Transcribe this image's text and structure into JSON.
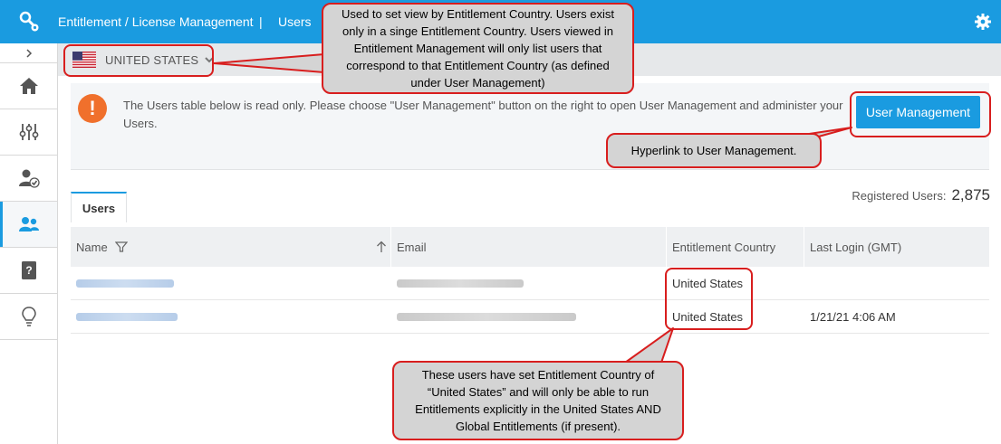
{
  "header": {
    "breadcrumb_section": "Entitlement / License Management",
    "breadcrumb_separator": "|",
    "breadcrumb_page": "Users"
  },
  "subheader": {
    "country": "UNITED STATES"
  },
  "notice": {
    "text": "The Users table below is read only. Please choose \"User Management\" button on the right to open User Management and administer your Users."
  },
  "actions": {
    "user_management_label": "User Management"
  },
  "tabs": [
    {
      "label": "Users",
      "active": true
    }
  ],
  "stats": {
    "registered_label": "Registered Users:",
    "registered_count": "2,875"
  },
  "table": {
    "columns": [
      "Name",
      "Email",
      "Entitlement Country",
      "Last Login (GMT)"
    ],
    "rows": [
      {
        "entitlement_country": "United States",
        "last_login": ""
      },
      {
        "entitlement_country": "United States",
        "last_login": "1/21/21 4:06 AM"
      }
    ]
  },
  "annotations": {
    "country_view": "Used to set view by Entitlement Country. Users exist only in a singe Entitlement Country. Users viewed in Entitlement Management will only list users that correspond to that Entitlement Country (as defined under User Management)",
    "hyperlink": "Hyperlink to User Management.",
    "users_country": "These users have  set Entitlement Country of “United States” and will only be able to run Entitlements explicitly in the United States AND Global Entitlements (if present)."
  },
  "colors": {
    "brand": "#1a9be0",
    "warning": "#f0702c",
    "annotation_border": "#d81e1e",
    "annotation_fill": "#d4d4d4"
  },
  "icons": {
    "app": "key-gear-icon",
    "settings": "gear-icon",
    "sidebar": [
      "home-icon",
      "sliders-icon",
      "user-check-icon",
      "users-icon",
      "book-question-icon",
      "lightbulb-icon"
    ]
  }
}
